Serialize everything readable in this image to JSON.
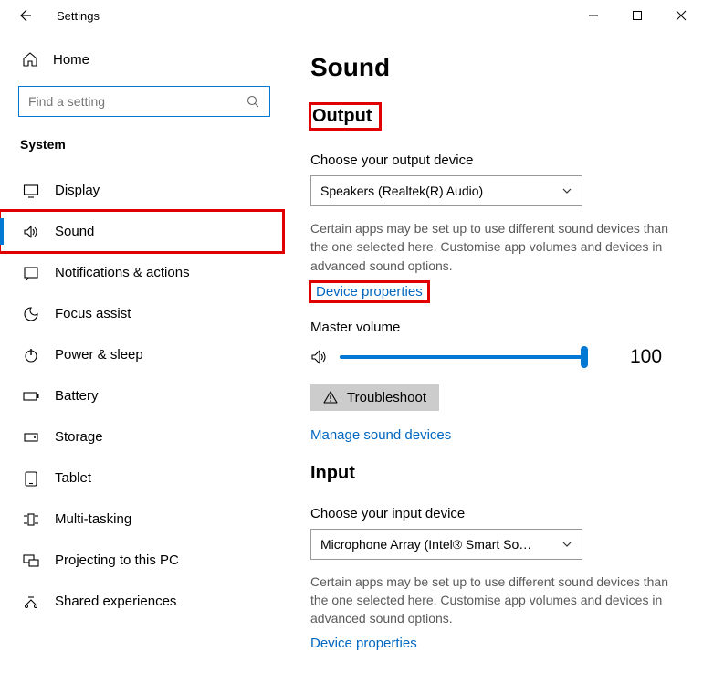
{
  "window": {
    "title": "Settings"
  },
  "sidebar": {
    "home_label": "Home",
    "search_placeholder": "Find a setting",
    "section_label": "System",
    "items": [
      {
        "label": "Display"
      },
      {
        "label": "Sound"
      },
      {
        "label": "Notifications & actions"
      },
      {
        "label": "Focus assist"
      },
      {
        "label": "Power & sleep"
      },
      {
        "label": "Battery"
      },
      {
        "label": "Storage"
      },
      {
        "label": "Tablet"
      },
      {
        "label": "Multi-tasking"
      },
      {
        "label": "Projecting to this PC"
      },
      {
        "label": "Shared experiences"
      }
    ]
  },
  "content": {
    "page_title": "Sound",
    "output": {
      "heading": "Output",
      "choose_label": "Choose your output device",
      "selected_device": "Speakers (Realtek(R) Audio)",
      "helptext": "Certain apps may be set up to use different sound devices than the one selected here. Customise app volumes and devices in advanced sound options.",
      "device_properties_label": "Device properties",
      "master_volume_label": "Master volume",
      "master_volume_value": "100",
      "troubleshoot_label": "Troubleshoot",
      "manage_label": "Manage sound devices"
    },
    "input": {
      "heading": "Input",
      "choose_label": "Choose your input device",
      "selected_device": "Microphone Array (Intel® Smart So…",
      "helptext": "Certain apps may be set up to use different sound devices than the one selected here. Customise app volumes and devices in advanced sound options.",
      "device_properties_label": "Device properties"
    }
  }
}
